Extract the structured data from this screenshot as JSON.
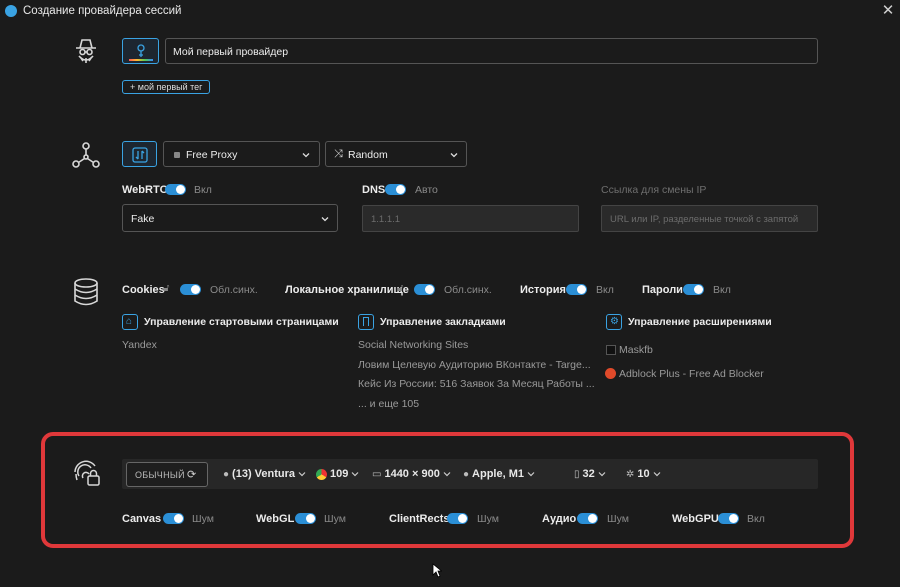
{
  "window": {
    "title": "Создание провайдера сессий"
  },
  "profile": {
    "name": "Мой первый провайдер",
    "tag": "+ мой первый тег"
  },
  "proxy": {
    "type": "Free Proxy",
    "mode": "Random",
    "webrtc_label": "WebRTC",
    "webrtc_state": "Вкл",
    "webrtc_value": "Fake",
    "dns_label": "DNS",
    "dns_state": "Авто",
    "dns_placeholder": "1.1.1.1",
    "ip_change_label": "Ссылка для смены IP",
    "ip_change_placeholder": "URL или IP, разделенные точкой с запятой"
  },
  "storage": {
    "cookies_label": "Cookies",
    "cookies_state": "Обл.синх.",
    "local_label": "Локальное хранилище",
    "local_state": "Обл.синх.",
    "history_label": "История",
    "history_state": "Вкл",
    "passwords_label": "Пароли",
    "passwords_state": "Вкл",
    "start_pages": {
      "title": "Управление стартовыми страницами",
      "items": [
        "Yandex"
      ]
    },
    "bookmarks": {
      "title": "Управление закладками",
      "items": [
        "Social Networking Sites",
        "Ловим Целевую Аудиторию ВКонтакте - Targe...",
        "Кейс Из России: 516 Заявок За Месяц Работы ...",
        "... и еще 105"
      ]
    },
    "extensions": {
      "title": "Управление расширениями",
      "items": [
        "Maskfb",
        "Adblock Plus - Free Ad Blocker"
      ]
    }
  },
  "fingerprint": {
    "mode_label": "ОБЫЧНЫЙ",
    "os": "(13) Ventura",
    "browser_version": "109",
    "resolution": "1440 × 900",
    "cpu": "Apple, M1",
    "memory": "32",
    "cores": "10",
    "canvas_label": "Canvas",
    "canvas_state": "Шум",
    "webgl_label": "WebGL",
    "webgl_state": "Шум",
    "clientrects_label": "ClientRects",
    "clientrects_state": "Шум",
    "audio_label": "Аудио",
    "audio_state": "Шум",
    "webgpu_label": "WebGPU",
    "webgpu_state": "Вкл"
  },
  "colors": {
    "accent": "#2b8fd6",
    "highlight": "#e0383a",
    "background": "#1b1b1b"
  }
}
